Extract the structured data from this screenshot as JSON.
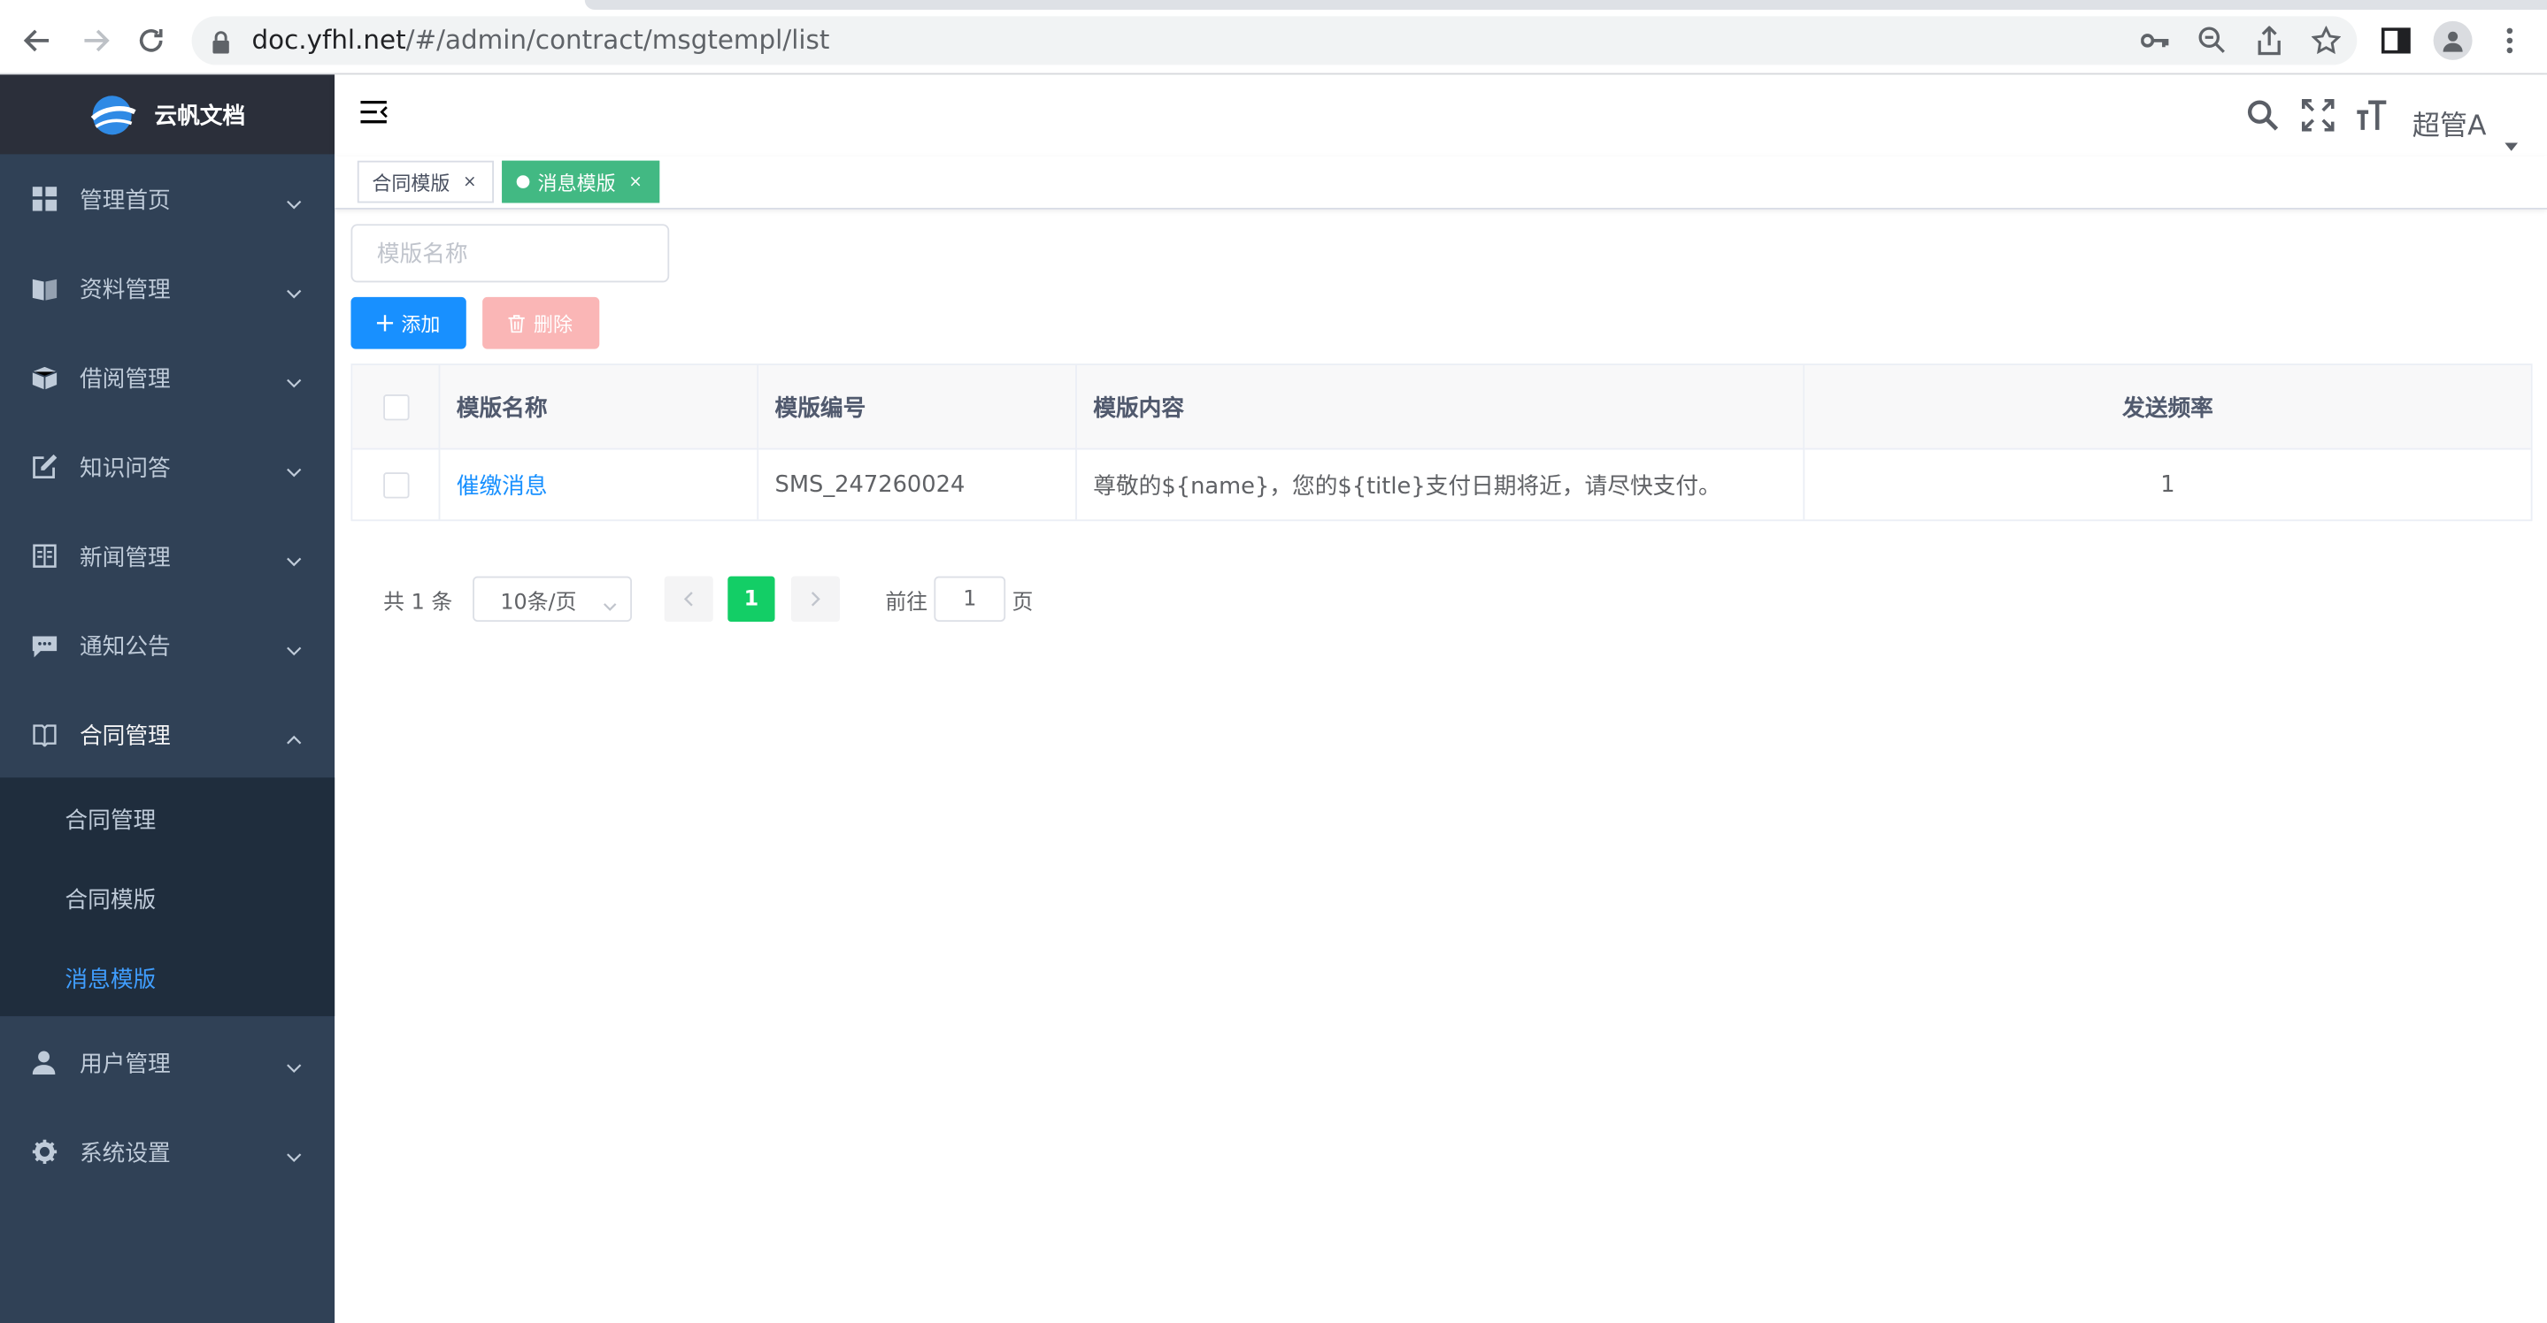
{
  "browser": {
    "url_host": "doc.yfhl.net",
    "url_path": "/#/admin/contract/msgtempl/list"
  },
  "app": {
    "logo_text": "云帆文档"
  },
  "sidebar": {
    "items": [
      {
        "label": "管理首页",
        "icon": "dashboard-icon"
      },
      {
        "label": "资料管理",
        "icon": "book-icon"
      },
      {
        "label": "借阅管理",
        "icon": "borrow-icon"
      },
      {
        "label": "知识问答",
        "icon": "edit-icon"
      },
      {
        "label": "新闻管理",
        "icon": "news-icon"
      },
      {
        "label": "通知公告",
        "icon": "message-icon"
      },
      {
        "label": "合同管理",
        "icon": "contract-icon"
      },
      {
        "label": "用户管理",
        "icon": "user-icon"
      },
      {
        "label": "系统设置",
        "icon": "gear-icon"
      }
    ],
    "submenu": [
      {
        "label": "合同管理"
      },
      {
        "label": "合同模版"
      },
      {
        "label": "消息模版"
      }
    ]
  },
  "navbar": {
    "user": "超管A"
  },
  "tags": [
    {
      "label": "合同模版",
      "close": "×"
    },
    {
      "label": "消息模版",
      "close": "×"
    }
  ],
  "filter": {
    "placeholder": "模版名称"
  },
  "toolbar": {
    "add_label": "添加",
    "delete_label": "删除"
  },
  "table": {
    "headers": [
      "模版名称",
      "模版编号",
      "模版内容",
      "发送频率"
    ],
    "rows": [
      {
        "name": "催缴消息",
        "code": "SMS_247260024",
        "content": "尊敬的${name}，您的${title}支付日期将近，请尽快支付。",
        "frequency": "1"
      }
    ]
  },
  "pagination": {
    "total_text": "共 1 条",
    "page_size": "10条/页",
    "current_page": "1",
    "goto_label": "前往",
    "goto_value": "1",
    "page_unit": "页"
  },
  "colors": {
    "sidebar_bg": "#304156",
    "accent": "#1890ff",
    "active_tag": "#42b983",
    "pager_active": "#13ce66"
  }
}
